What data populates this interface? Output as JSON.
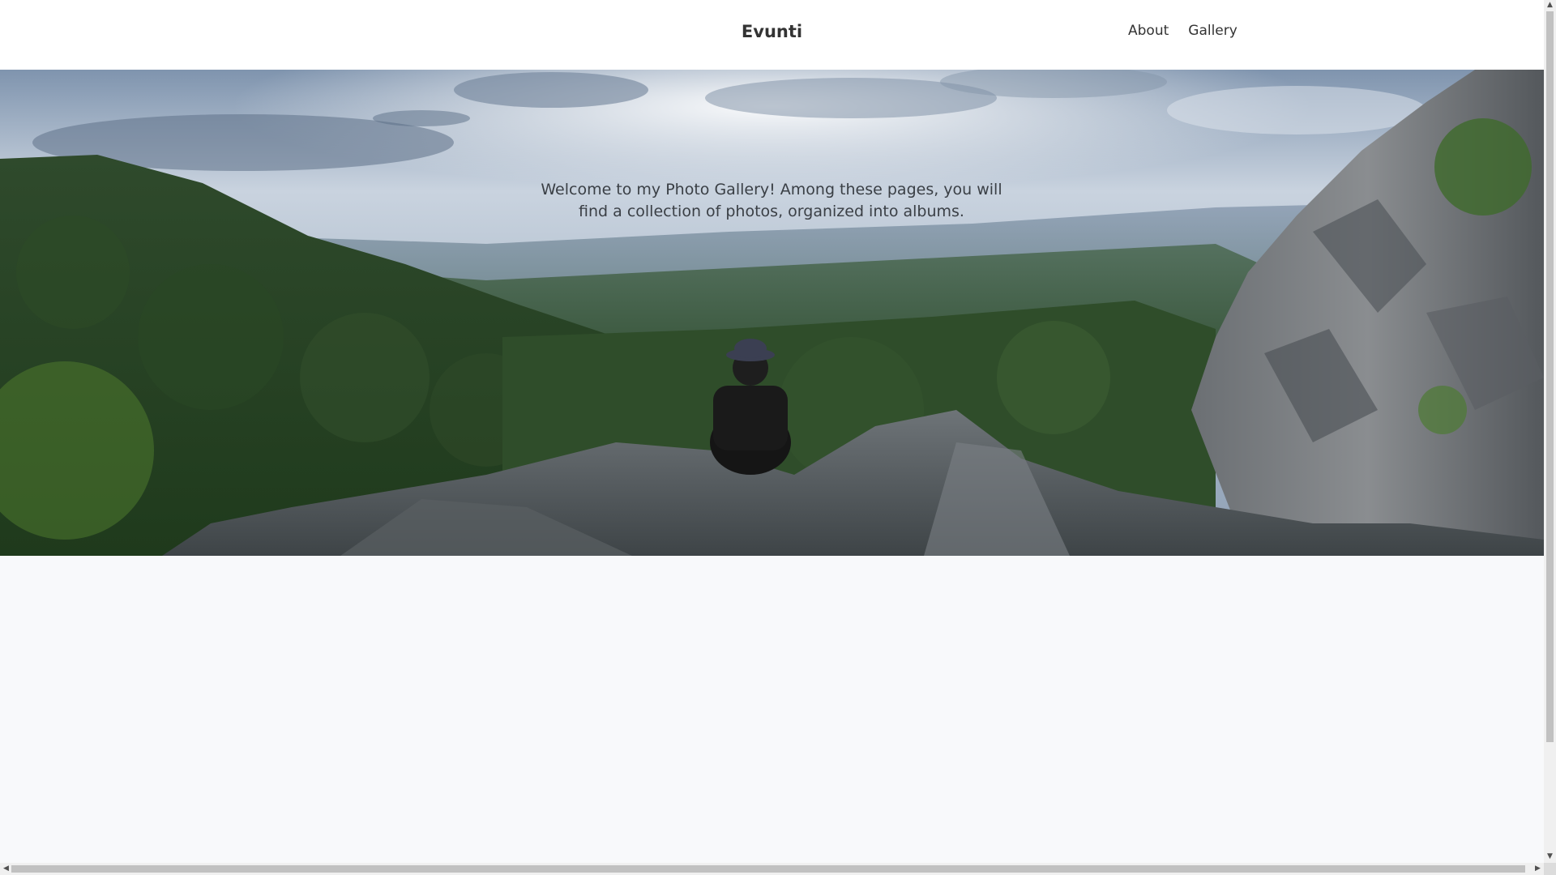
{
  "navbar": {
    "brand": "Evunti",
    "links": [
      "About",
      "Gallery"
    ]
  },
  "hero": {
    "text": "Welcome to my Photo Gallery! Among these pages, you will find a collection of photos, organized into albums."
  },
  "scrollbars": {
    "up_icon": "arrow-up-icon",
    "down_icon": "arrow-down-icon",
    "left_icon": "arrow-left-icon",
    "right_icon": "arrow-right-icon"
  }
}
